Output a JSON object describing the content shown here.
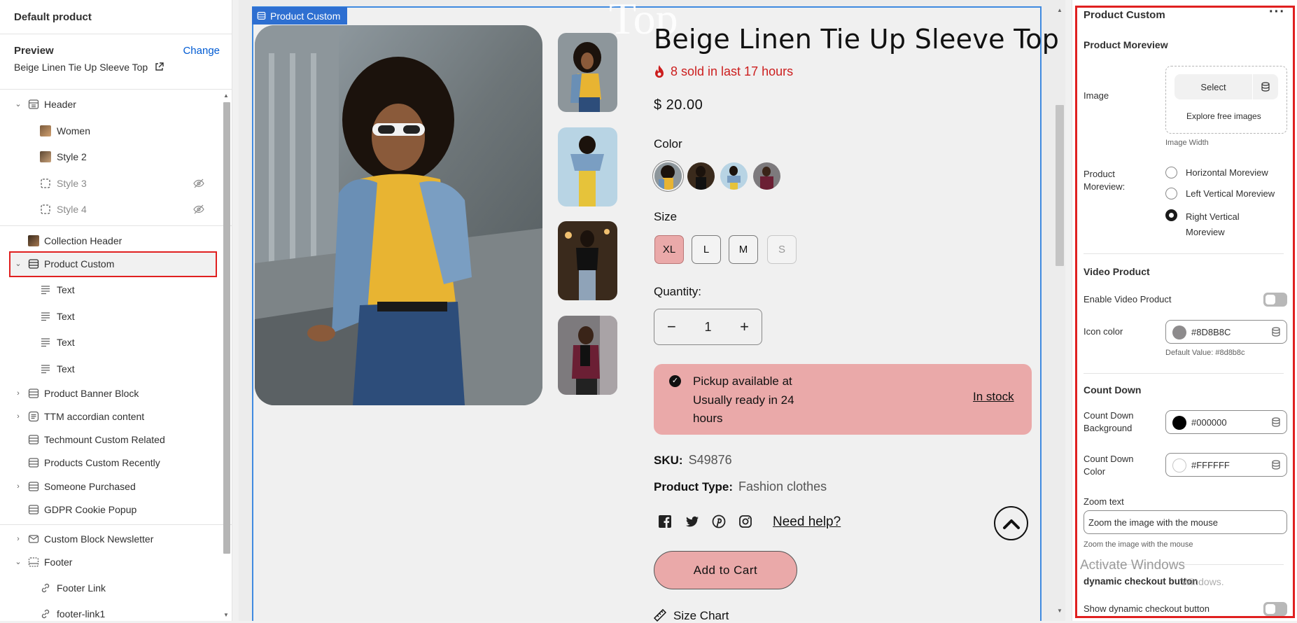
{
  "left_panel": {
    "title": "Default product",
    "preview_label": "Preview",
    "change_label": "Change",
    "preview_name": "Beige Linen Tie Up Sleeve Top",
    "tree": [
      {
        "label": "Header"
      },
      {
        "label": "Women"
      },
      {
        "label": "Style 2"
      },
      {
        "label": "Style 3",
        "hidden": true
      },
      {
        "label": "Style 4",
        "hidden": true
      },
      {
        "label": "Collection Header"
      },
      {
        "label": "Product Custom",
        "selected": true
      },
      {
        "label": "Text"
      },
      {
        "label": "Text"
      },
      {
        "label": "Text"
      },
      {
        "label": "Text"
      },
      {
        "label": "Product Banner Block"
      },
      {
        "label": "TTM accordian content"
      },
      {
        "label": "Techmount Custom Related"
      },
      {
        "label": "Products Custom Recently"
      },
      {
        "label": "Someone Purchased"
      },
      {
        "label": "GDPR Cookie Popup"
      },
      {
        "label": "Custom Block Newsletter"
      },
      {
        "label": "Footer"
      },
      {
        "label": "Footer Link"
      },
      {
        "label": "footer-link1"
      }
    ]
  },
  "canvas": {
    "section_tag": "Product Custom",
    "ghost_text": "Top",
    "product": {
      "title": "Beige Linen Tie Up Sleeve Top",
      "sold_text": "8 sold in last 17 hours",
      "price": "$ 20.00",
      "color_label": "Color",
      "size_label": "Size",
      "sizes": [
        "XL",
        "L",
        "M",
        "S"
      ],
      "selected_size": "XL",
      "quantity_label": "Quantity:",
      "quantity_value": "1",
      "pickup_text": "Pickup available at Usually ready in 24 hours",
      "stock_link": "In stock",
      "sku_label": "SKU:",
      "sku_value": "S49876",
      "type_label": "Product Type:",
      "type_value": "Fashion clothes",
      "need_help": "Need help?",
      "add_to_cart": "Add to Cart",
      "size_chart": "Size Chart"
    },
    "colors": {
      "accent_pink": "#eaa9a9",
      "sold_red": "#cc1e1e",
      "frame_blue": "#3f8ae0"
    }
  },
  "right_panel": {
    "title": "Product Custom",
    "moreview_heading": "Product Moreview",
    "image_label": "Image",
    "select_label": "Select",
    "explore_label": "Explore free images",
    "image_width_label": "Image Width",
    "moreview_label": "Product Moreview:",
    "moreview_options": [
      "Horizontal Moreview",
      "Left Vertical Moreview",
      "Right Vertical Moreview"
    ],
    "moreview_selected": "Right Vertical Moreview",
    "video_heading": "Video Product",
    "enable_video_label": "Enable Video Product",
    "icon_color_label": "Icon color",
    "icon_color_value": "#8D8B8C",
    "icon_color_default": "Default Value: #8d8b8c",
    "countdown_heading": "Count Down",
    "countdown_bg_label": "Count Down Background",
    "countdown_bg_value": "#000000",
    "countdown_color_label": "Count Down Color",
    "countdown_color_value": "#FFFFFF",
    "zoom_label": "Zoom text",
    "zoom_value": "Zoom the image with the mouse",
    "zoom_help": "Zoom the image with the mouse",
    "dynamic_heading": "dynamic checkout button",
    "dynamic_toggle_label": "Show dynamic checkout button"
  },
  "watermark": {
    "line1": "Activate Windows",
    "line2": "Windows."
  }
}
